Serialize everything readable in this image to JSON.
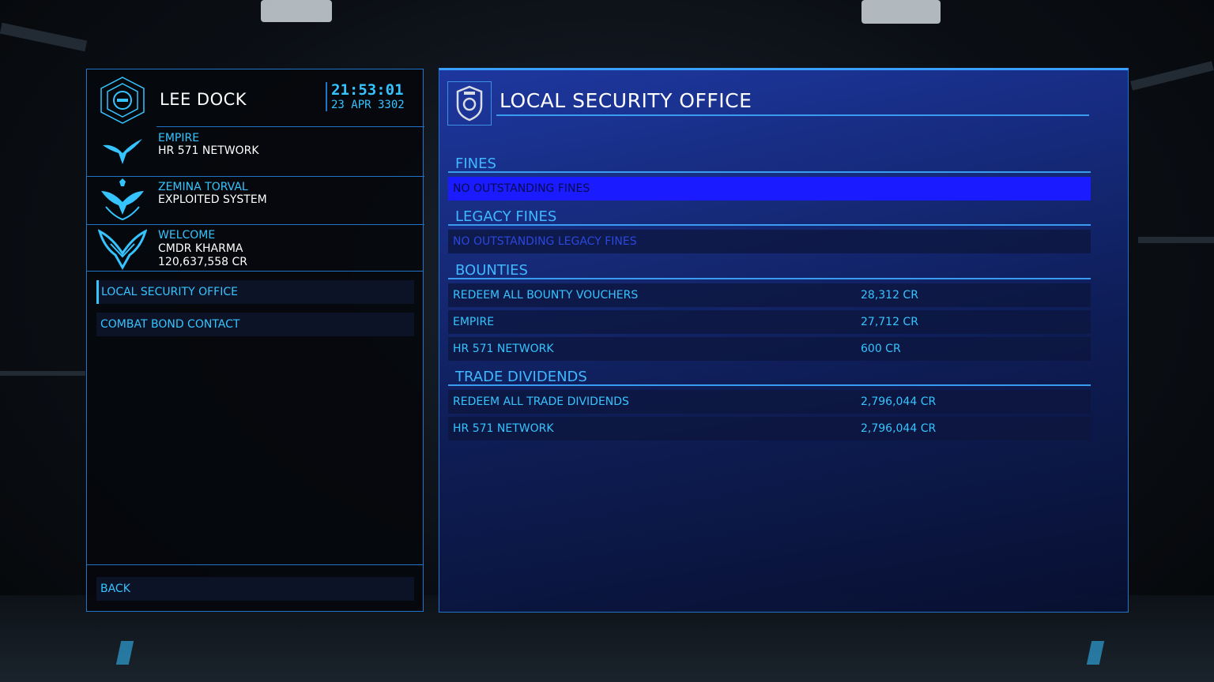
{
  "station": {
    "name": "LEE DOCK",
    "time": "21:53:01",
    "date": "23 APR 3302"
  },
  "faction_info": [
    {
      "label": "EMPIRE",
      "value": "HR 571 NETWORK"
    },
    {
      "label": "ZEMINA TORVAL",
      "value": "EXPLOITED SYSTEM"
    },
    {
      "label": "WELCOME",
      "value": "CMDR KHARMA",
      "credits": "120,637,558 CR"
    }
  ],
  "menu": {
    "items": [
      {
        "label": "LOCAL SECURITY OFFICE",
        "active": true
      },
      {
        "label": "COMBAT BOND CONTACT",
        "active": false
      }
    ],
    "back_label": "BACK"
  },
  "main": {
    "title": "LOCAL SECURITY OFFICE",
    "fines": {
      "title": "FINES",
      "rows": [
        {
          "label": "NO OUTSTANDING FINES"
        }
      ]
    },
    "legacy_fines": {
      "title": "LEGACY FINES",
      "rows": [
        {
          "label": "NO OUTSTANDING LEGACY FINES"
        }
      ]
    },
    "bounties": {
      "title": "BOUNTIES",
      "rows": [
        {
          "label": "REDEEM ALL BOUNTY VOUCHERS",
          "amount": "28,312 CR"
        },
        {
          "label": "EMPIRE",
          "amount": "27,712 CR"
        },
        {
          "label": "HR 571 NETWORK",
          "amount": "600 CR"
        }
      ]
    },
    "trade_dividends": {
      "title": "TRADE DIVIDENDS",
      "rows": [
        {
          "label": "REDEEM ALL TRADE DIVIDENDS",
          "amount": "2,796,044 CR"
        },
        {
          "label": "HR 571 NETWORK",
          "amount": "2,796,044 CR"
        }
      ]
    }
  },
  "colors": {
    "accent": "#35c4ff",
    "panel_blue": "#1e3aaa",
    "highlight": "#1a1cff",
    "border": "#1f74c8"
  }
}
